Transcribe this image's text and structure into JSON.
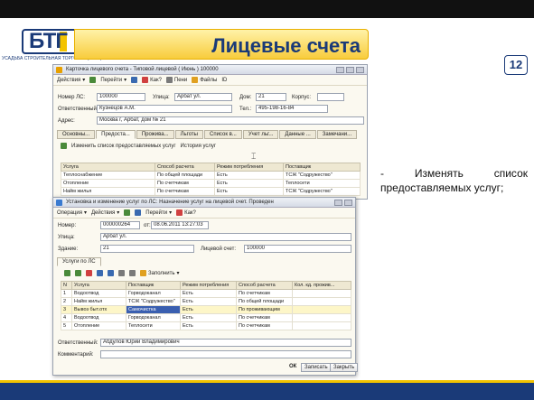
{
  "header": {
    "title": "Лицевые счета",
    "logo_text": "БТГ",
    "logo_subtitle": "УСАДЬБА СТРОИТЕЛЬНАЯ ТОРГОВАЯ (БИТГ)",
    "page_number": "12"
  },
  "note": "- Изменять список предоставляемых услуг;",
  "colors": {
    "brand_blue": "#1a3a78",
    "accent_yellow": "#f8cc3c"
  },
  "win1": {
    "title": "Карточка лицевого счета - Типовой лицевой ( Июнь ) 100000",
    "toolbar": [
      {
        "label": "Действия",
        "icon": "actions-icon"
      },
      {
        "label": "Перейти",
        "icon": "goto-icon"
      },
      {
        "label": "Как?",
        "icon": "help-icon"
      },
      {
        "label": "Пени",
        "icon": "penalty-icon"
      },
      {
        "label": "Файлы",
        "icon": "files-icon"
      },
      {
        "label": "ID",
        "icon": "id-icon"
      }
    ],
    "fields": {
      "number_label": "Номер ЛС:",
      "number": "100000",
      "street_label": "Улица:",
      "street": "Арбат ул.",
      "house_label": "Дом:",
      "house": "21",
      "corpus_label": "Корпус:",
      "corpus": "",
      "owner_label": "Ответственный:",
      "owner": "Кузнецов А.М.",
      "phone_label": "Тел.:",
      "phone": "495-198-16-84",
      "address_label": "Адрес:",
      "address": "Москва г, Арбат, дом № 21"
    },
    "tabs": [
      "Основны...",
      "Предоста...",
      "Прожива...",
      "Льготы",
      "Список в...",
      "Учет льг...",
      "Данные ...",
      "Замечани..."
    ],
    "subtoolbar": {
      "change": "Изменить список предоставляемых услуг",
      "history": "История услуг"
    },
    "columns": [
      "Услуга",
      "Способ расчета",
      "Режим потребления",
      "Поставщик"
    ],
    "rows": [
      [
        "Теплоснабжение",
        "По общей площади",
        "Есть",
        "ТСЖ \"Содружество\""
      ],
      [
        "Отопление",
        "По счетчикам",
        "Есть",
        "Теплосети"
      ],
      [
        "Найм жилья",
        "По счетчикам",
        "Есть",
        "ТСЖ \"Содружество\""
      ]
    ]
  },
  "win2": {
    "title": "Установка и изменение услуг по ЛС: Назначение услуг на лицевой счет. Проведен",
    "toolbar": [
      {
        "label": "Операция",
        "icon": "operation-icon"
      },
      {
        "label": "Действия",
        "icon": "actions-icon"
      },
      {
        "label": "Перейти",
        "icon": "goto-icon"
      },
      {
        "label": "Как?",
        "icon": "help-icon"
      }
    ],
    "fields": {
      "number_label": "Номер:",
      "number": "000000264",
      "date_label": "от:",
      "date": "08.06.2011 13:27:03",
      "street_label": "Улица:",
      "street": "Арбат ул.",
      "building_label": "Здание:",
      "building": "21",
      "account_label": "Лицевой счет:",
      "account": "100000"
    },
    "tab": "Услуги по ЛС",
    "fill_button": "Заполнить",
    "columns": [
      "N",
      "Услуга",
      "Поставщик",
      "Режим потребления",
      "Способ расчета",
      "Кол. кд. прожив..."
    ],
    "rows": [
      [
        "1",
        "Водоотвод",
        "Горводоканал",
        "Есть",
        "По счетчикам",
        ""
      ],
      [
        "2",
        "Найм жилья",
        "ТСЖ \"Содружество\"",
        "Есть",
        "По общей площади",
        ""
      ],
      [
        "3",
        "Вывоз быт.отх",
        "Самочистка",
        "Есть",
        "По проживающим",
        ""
      ],
      [
        "4",
        "Водоотвод",
        "Горводоканал",
        "Есть",
        "По счетчикам",
        ""
      ],
      [
        "5",
        "Отопление",
        "Теплосети",
        "Есть",
        "По счетчикам",
        ""
      ]
    ],
    "responsible_label": "Ответственный:",
    "responsible": "Абдулов Юрий Владимирович",
    "comment_label": "Комментарий:",
    "comment": "",
    "buttons": {
      "ok": "ОК",
      "save": "Записать",
      "close": "Закрыть"
    }
  }
}
